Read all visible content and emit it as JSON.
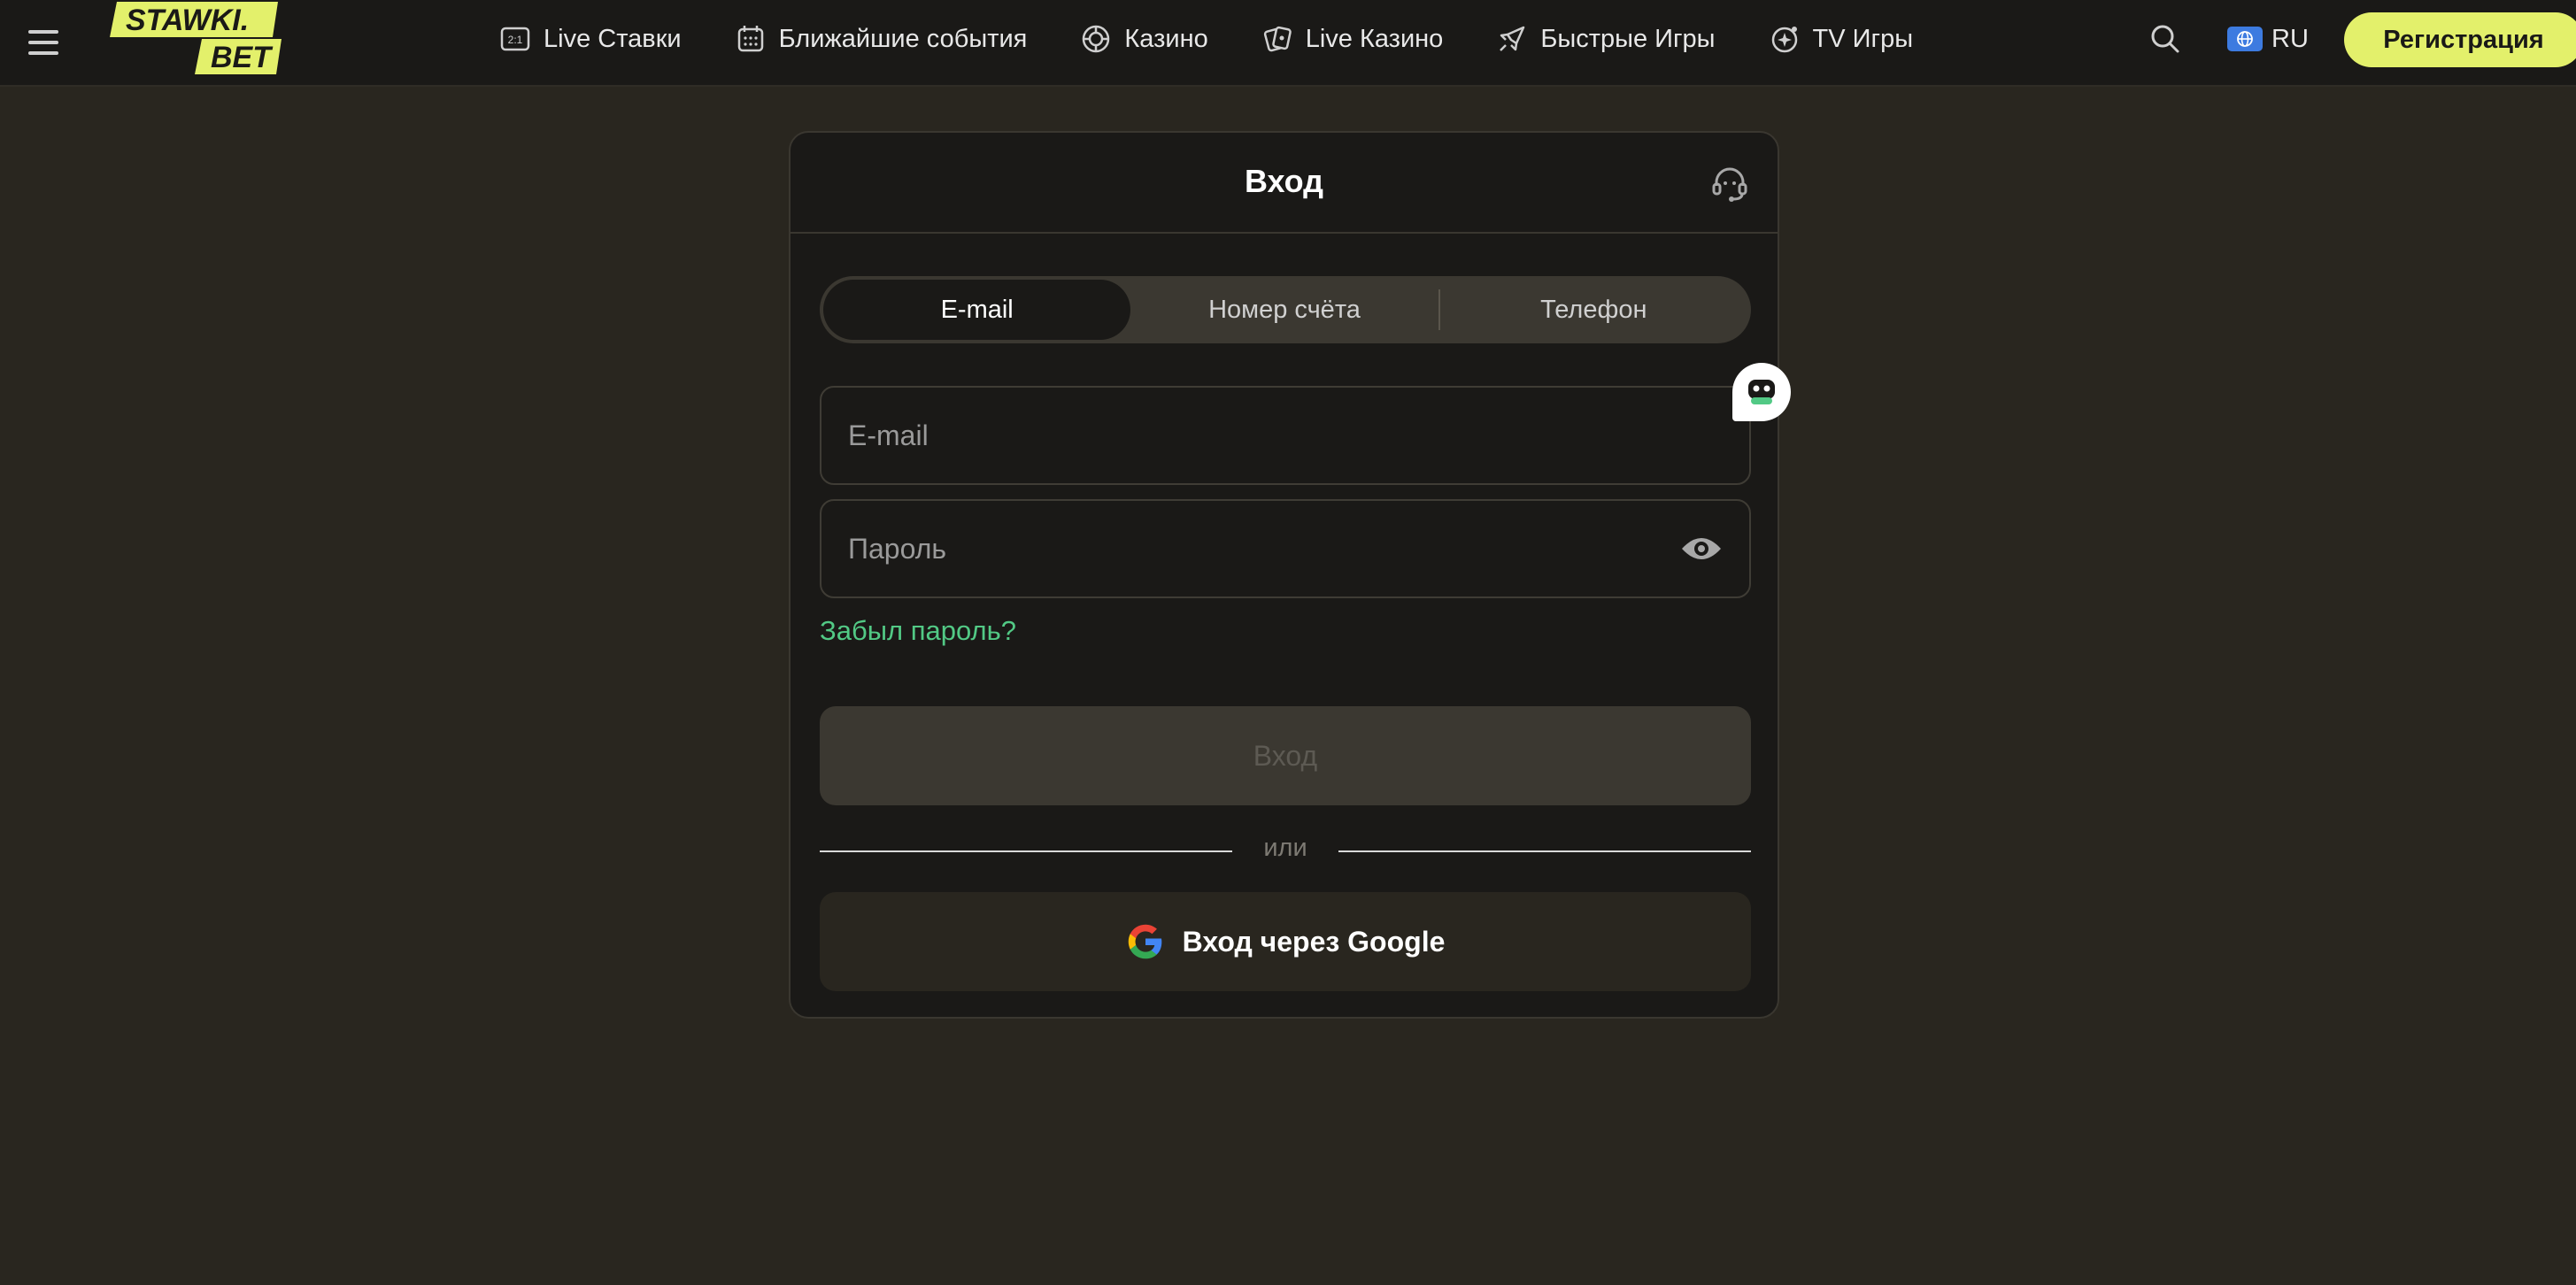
{
  "header": {
    "logo": {
      "line1": "STAWKI.",
      "line2": "BET"
    },
    "nav": [
      {
        "label": "Live Ставки",
        "icon": "live-bets-icon"
      },
      {
        "label": "Ближайшие события",
        "icon": "calendar-icon"
      },
      {
        "label": "Казино",
        "icon": "casino-chip-icon"
      },
      {
        "label": "Live Казино",
        "icon": "playing-cards-icon"
      },
      {
        "label": "Быстрые Игры",
        "icon": "rocket-icon"
      },
      {
        "label": "TV Игры",
        "icon": "tv-games-icon"
      }
    ],
    "language": "RU",
    "register_label": "Регистрация"
  },
  "login": {
    "title": "Вход",
    "tabs": [
      "E-mail",
      "Номер счёта",
      "Телефон"
    ],
    "active_tab": "E-mail",
    "email_placeholder": "E-mail",
    "password_placeholder": "Пароль",
    "forgot_label": "Забыл пароль?",
    "submit_label": "Вход",
    "divider_label": "или",
    "google_label": "Вход через Google"
  },
  "colors": {
    "page_bg": "#29261f",
    "header_bg": "#1a1917",
    "modal_bg": "#1a1917",
    "accent_yellow": "#e3f06b",
    "link_green": "#52c985",
    "disabled_text": "#5d5a53"
  }
}
